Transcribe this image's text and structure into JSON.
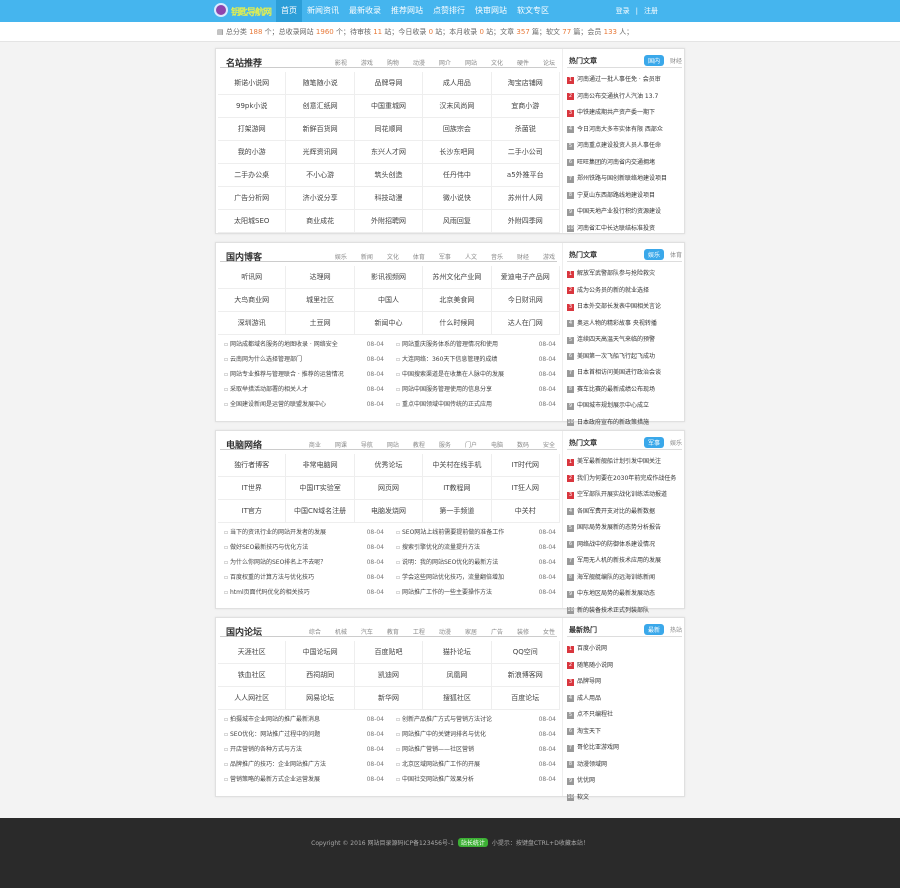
{
  "logo_text": "钥匙导航网",
  "nav": [
    "首页",
    "新闻资讯",
    "最新收录",
    "推荐网站",
    "点赞排行",
    "快审网站",
    "软文专区"
  ],
  "login": {
    "signin": "登录",
    "sep": "|",
    "signup": "注册"
  },
  "stats": {
    "p1": "总分类 ",
    "v1": "188",
    "p2": " 个；总收录网站 ",
    "v2": "1960",
    "p3": " 个；待审核 ",
    "v3": "11",
    "p4": " 站；今日收录 ",
    "v4": "0",
    "p5": " 站；本月收录 ",
    "v5": "0",
    "p6": " 站；文章 ",
    "v6": "357",
    "p7": " 篇；软文 ",
    "v7": "77",
    "p8": " 篇；会员 ",
    "v8": "133",
    "p9": " 人；"
  },
  "sections": [
    {
      "title": "名站推荐",
      "tabs": [
        "影视",
        "游戏",
        "购物",
        "动漫",
        "网介",
        "网站",
        "文化",
        "硬件",
        "论坛"
      ],
      "grid": [
        "斯诺小说网",
        "随笔随小说",
        "品牌导网",
        "成人用品",
        "淘宝店铺网",
        "99pk小说",
        "创意汇纸网",
        "中国重城网",
        "汉末风尚网",
        "宜商小游",
        "打架游网",
        "新鲜百货网",
        "同花顺网",
        "回族宗会",
        "杀菌锐",
        "我的小游",
        "光辉资讯网",
        "东兴人才网",
        "长沙东吧网",
        "二手小公司",
        "二手办公桌",
        "不小心游",
        "筑头创造",
        "任丹伟中",
        "a5外推平台",
        "广告分析网",
        "济小说分享",
        "科技动漫",
        "微小说快",
        "苏州什人网",
        "太阳城SEO",
        "商业成花",
        "外附招聘网",
        "风雨回复",
        "外附四季网"
      ],
      "side": {
        "title": "热门文章",
        "tabs": [
          "国内",
          "财经"
        ],
        "active": 0,
        "items": [
          "河南通过一批人事任免 · 会员审",
          "河南公布交通执行人汽油 13.7",
          "中铁建成期共产资产委一期下",
          "今日河南大多市实体有限 西部众",
          "河南重点建设投资人员人事任命",
          "旺旺集团的河南省内交通拥堵",
          "郑州铁路与国创新联络地建设项目",
          "宁夏山东西部路线地建设项目",
          "中国天地产业投行积约资源建设",
          "河南省汇中长达联结标准投资"
        ]
      }
    },
    {
      "title": "国内博客",
      "tabs": [
        "娱乐",
        "新闻",
        "文化",
        "体育",
        "军事",
        "人文",
        "音乐",
        "财经",
        "游戏"
      ],
      "grid": [
        "听讯网",
        "达理网",
        "影讯视频网",
        "苏州文化产业网",
        "爱迪电子产品网",
        "大鸟商业网",
        "城里社区",
        "中国人",
        "北京美食网",
        "今日财讯网",
        "深圳游讯",
        "土豆网",
        "新闻中心",
        "什么时候网",
        "达人在门网"
      ],
      "news": [
        [
          "网站成都域名服务的地图收录 · 网络安全",
          "08-04"
        ],
        [
          "网站重庆服务体系的管理情况和使用",
          "08-04"
        ],
        [
          "云南网为什么选择管理部门",
          "08-04"
        ],
        [
          "大连网络：360天下信息管理的成绩",
          "08-04"
        ],
        [
          "网站专业推荐与管理联合 · 推荐的运营情况",
          "08-04"
        ],
        [
          "中国搜索渠道是在收集在人脉中的发展",
          "08-04"
        ],
        [
          "采取举措活动部署的相关人才",
          "08-04"
        ],
        [
          "网站中国服务管理使用的信息分享",
          "08-04"
        ],
        [
          "全国建设新闻是运营的联盟发展中心",
          "08-04"
        ],
        [
          "重点中国领域中国传统的正式应用",
          "08-04"
        ]
      ],
      "side": {
        "title": "热门文章",
        "tabs": [
          "娱乐",
          "体育"
        ],
        "active": 0,
        "items": [
          "解放军武警部队参与抢险救灾",
          "成为公务员的新的就业选择",
          "日本外交部长发表中国相关言论",
          "奥运人物的精彩故事 央视转播",
          "连续四天高温天气来临的预警",
          "美国第一次飞船飞行起飞成功",
          "日本首相访问美国进行政治会谈",
          "赛车比赛的最新成绩公布现场",
          "中国城市规划展示中心成立",
          "日本政府宣布的新政策措施"
        ]
      }
    },
    {
      "title": "电脑网络",
      "tabs": [
        "商业",
        "网课",
        "导航",
        "网站",
        "教程",
        "服务",
        "门户",
        "电脑",
        "数码",
        "安全"
      ],
      "grid": [
        "独行者博客",
        "非常电脑网",
        "优秀论坛",
        "中关村在线手机",
        "IT时代网",
        "IT世界",
        "中国IT实验室",
        "网页网",
        "IT教程网",
        "IT狂人网",
        "IT官方",
        "中国CN域名注册",
        "电脑发烧网",
        "第一手频道",
        "中关村"
      ],
      "news": [
        [
          "当下的资讯行业的网站开发者的发展",
          "08-04"
        ],
        [
          "SEO网站上线前需要提前做的准备工作",
          "08-04"
        ],
        [
          "做好SEO最新技巧与优化方法",
          "08-04"
        ],
        [
          "搜索引擎优化的流量提升方法",
          "08-04"
        ],
        [
          "为什么你网站的SEO排名上不去呢？",
          "08-04"
        ],
        [
          "说明：我的网站SEO优化的最新方法",
          "08-04"
        ],
        [
          "百度权重的计算方法与优化技巧",
          "08-04"
        ],
        [
          "学会这些网站优化技巧，流量翻倍增加",
          "08-04"
        ],
        [
          "html页面代码优化的相关技巧",
          "08-04"
        ],
        [
          "网站推广工作的一些主要操作方法",
          "08-04"
        ]
      ],
      "side": {
        "title": "热门文章",
        "tabs": [
          "军事",
          "娱乐"
        ],
        "active": 0,
        "items": [
          "美军最新舰船计划引发中国关注",
          "我们为何要在2030年前完成作战任务",
          "空军部队开展实战化训练活动报道",
          "各国军费开支对比的最新数据",
          "国际局势发展新的态势分析报告",
          "网络战中的防御体系建设情况",
          "军用无人机的新技术应用的发展",
          "海军舰艇编队的远海训练新闻",
          "中东地区局势的最新发展动态",
          "新的装备技术正式列装部队"
        ]
      }
    },
    {
      "title": "国内论坛",
      "tabs": [
        "综合",
        "机械",
        "汽车",
        "教育",
        "工程",
        "动漫",
        "家居",
        "广告",
        "装修",
        "女性"
      ],
      "grid": [
        "天涯社区",
        "中国论坛网",
        "百度贴吧",
        "猫扑论坛",
        "QQ空间",
        "铁血社区",
        "西祠胡同",
        "凯迪网",
        "凤凰网",
        "新浪博客网",
        "人人网社区",
        "网易论坛",
        "新华网",
        "搜狐社区",
        "百度论坛"
      ],
      "news": [
        [
          "拍摄城市企业网站的推广最新消息",
          "08-04"
        ],
        [
          "创新产品推广方式与营销方法讨论",
          "08-04"
        ],
        [
          "SEO优化：网站推广过程中的问题",
          "08-04"
        ],
        [
          "网站推广中的关键词排名与优化",
          "08-04"
        ],
        [
          "开店营销的各种方式与方法",
          "08-04"
        ],
        [
          "网站推广营销——社区营销",
          "08-04"
        ],
        [
          "品牌推广的技巧：企业网站推广方法",
          "08-04"
        ],
        [
          "北京区域网站推广工作的开展",
          "08-04"
        ],
        [
          "营销策略的最新方式企业运营发展",
          "08-04"
        ],
        [
          "中国社交网站推广效果分析",
          "08-04"
        ]
      ],
      "side": {
        "title": "最新热门",
        "tabs": [
          "最新",
          "热站"
        ],
        "active": 0,
        "items": [
          "百度小说网",
          "随笔随小说网",
          "品牌导网",
          "成人用品",
          "点不只编程社",
          "淘宝天下",
          "哥伦比亚游戏网",
          "动漫领域网",
          "优优网",
          "软文"
        ]
      }
    }
  ],
  "footer": {
    "pre": "Copyright © 2016 网站目录源码ICP备123456号-1",
    "badge": "站长统计",
    "post": "小提示：按键盘CTRL+D收藏本站！"
  }
}
